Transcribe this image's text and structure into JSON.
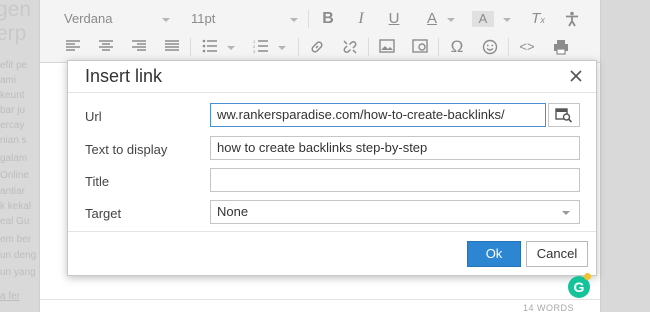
{
  "background": {
    "big_lines": [
      "gen",
      "erp"
    ],
    "lines": [
      "efit pe",
      "ami",
      "keunt",
      "bar ju",
      "ercay",
      "nian s",
      "galam",
      "Online",
      "antiar",
      "k kekal",
      "eal Gu",
      "em ber",
      "un deng",
      "un yang",
      "a fer"
    ]
  },
  "toolbar": {
    "font_family": "Verdana",
    "font_size": "11pt",
    "icons": [
      "bold-icon",
      "italic-icon",
      "underline-icon",
      "font-color-icon",
      "highlight-icon",
      "clear-format-icon",
      "accessibility-icon",
      "align-left-icon",
      "align-center-icon",
      "align-right-icon",
      "align-justify-icon",
      "bullet-list-icon",
      "numbered-list-icon",
      "link-icon",
      "unlink-icon",
      "image-icon",
      "media-icon",
      "special-char-icon",
      "emoji-icon",
      "source-code-icon",
      "print-icon"
    ]
  },
  "dialog": {
    "title": "Insert link",
    "url_label": "Url",
    "url_value": "ww.rankersparadise.com/how-to-create-backlinks/",
    "text_label": "Text to display",
    "text_value": "how to create backlinks step-by-step",
    "title_label": "Title",
    "title_value": "",
    "target_label": "Target",
    "target_value": "None",
    "ok_label": "Ok",
    "cancel_label": "Cancel"
  },
  "editor": {
    "word_count": "14 WORDS"
  },
  "colors": {
    "ok_button": "#2d86d1",
    "focus_border": "#4a90d9",
    "grammarly": "#15c39a"
  }
}
